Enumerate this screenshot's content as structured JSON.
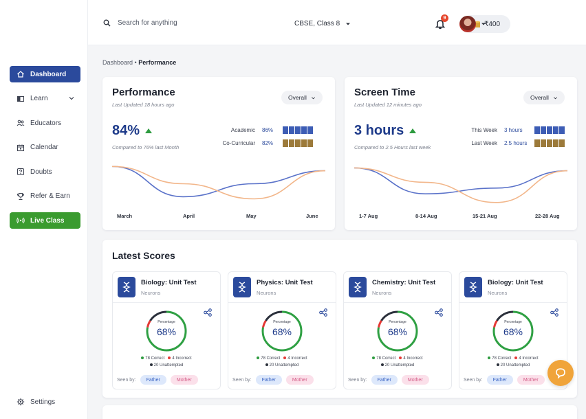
{
  "search": {
    "placeholder": "Search for anything"
  },
  "header": {
    "board": "CBSE, Class 8",
    "coins": "₹400",
    "notif_count": "9"
  },
  "sidebar": {
    "items": [
      {
        "label": "Dashboard",
        "icon": "home-icon",
        "state": "active"
      },
      {
        "label": "Learn",
        "icon": "book-icon",
        "has_dropdown": true
      },
      {
        "label": "Educators",
        "icon": "people-icon"
      },
      {
        "label": "Calendar",
        "icon": "calendar-icon"
      },
      {
        "label": "Doubts",
        "icon": "doubt-icon"
      },
      {
        "label": "Refer & Earn",
        "icon": "trophy-icon"
      },
      {
        "label": "Live Class",
        "icon": "broadcast-icon",
        "state": "live"
      }
    ],
    "settings_label": "Settings"
  },
  "breadcrumb": {
    "parent": "Dashboard",
    "separator": "•",
    "current": "Performance"
  },
  "performance": {
    "title": "Performance",
    "updated": "Last Updated 18 hours ago",
    "filter": "Overall",
    "value": "84%",
    "compare": "Compared to 76% last Month",
    "stats": [
      {
        "label": "Academic",
        "value": "86%",
        "color": "#3d5db5"
      },
      {
        "label": "Co-Curricular",
        "value": "82%",
        "color": "#9c7a3a"
      }
    ]
  },
  "screen_time": {
    "title": "Screen Time",
    "updated": "Last Updated 12 minutes ago",
    "filter": "Overall",
    "value": "3 hours",
    "compare": "Compared to 2.5 Hours last week",
    "stats": [
      {
        "label": "This Week",
        "value": "3 hours",
        "color": "#3d5db5"
      },
      {
        "label": "Last Week",
        "value": "2.5 hours",
        "color": "#9c7a3a"
      }
    ]
  },
  "chart_data": [
    {
      "type": "line",
      "x": [
        "March",
        "April",
        "May",
        "June"
      ],
      "series": [
        {
          "values": [
            88,
            74,
            80,
            86
          ],
          "color": "#5a72c9"
        },
        {
          "values": [
            88,
            80,
            73,
            86
          ],
          "color": "#f2b68a"
        }
      ],
      "ylim": [
        70,
        90
      ]
    },
    {
      "type": "line",
      "x": [
        "1-7 Aug",
        "8-14 Aug",
        "15-21 Aug",
        "22-28 Aug"
      ],
      "series": [
        {
          "values": [
            3.3,
            2.4,
            2.6,
            3.2
          ],
          "color": "#5a72c9"
        },
        {
          "values": [
            3.3,
            2.8,
            2.1,
            3.2
          ],
          "color": "#f2b68a"
        }
      ],
      "ylim": [
        2.0,
        3.5
      ]
    }
  ],
  "scores": {
    "title": "Latest Scores",
    "percentage_label": "Percentage",
    "seen_by_label": "Seen by:",
    "items": [
      {
        "subject": "Biology: Unit Test",
        "topic": "Neurons",
        "percent": "68%",
        "correct": "78 Correct",
        "incorrect": "4 Incorrect",
        "unattempted": "20 Unattempted",
        "seen": [
          "Father",
          "Mother"
        ]
      },
      {
        "subject": "Physics: Unit Test",
        "topic": "Neurons",
        "percent": "68%",
        "correct": "78 Correct",
        "incorrect": "4 Incorrect",
        "unattempted": "20 Unattempted",
        "seen": [
          "Father",
          "Mother"
        ]
      },
      {
        "subject": "Chemistry: Unit Test",
        "topic": "Neurons",
        "percent": "68%",
        "correct": "78 Correct",
        "incorrect": "4 Incorrect",
        "unattempted": "20 Unattempted",
        "seen": [
          "Father",
          "Mother"
        ]
      },
      {
        "subject": "Biology: Unit Test",
        "topic": "Neurons",
        "percent": "68%",
        "correct": "78 Correct",
        "incorrect": "4 Incorrect",
        "unattempted": "20 Unattempted",
        "seen": [
          "Father",
          "Mother"
        ]
      }
    ]
  },
  "colors": {
    "primary": "#2b4a9c",
    "live": "#3a9b2f",
    "correct": "#2d9b3f",
    "incorrect": "#e53935",
    "accent": "#f0a43a"
  }
}
